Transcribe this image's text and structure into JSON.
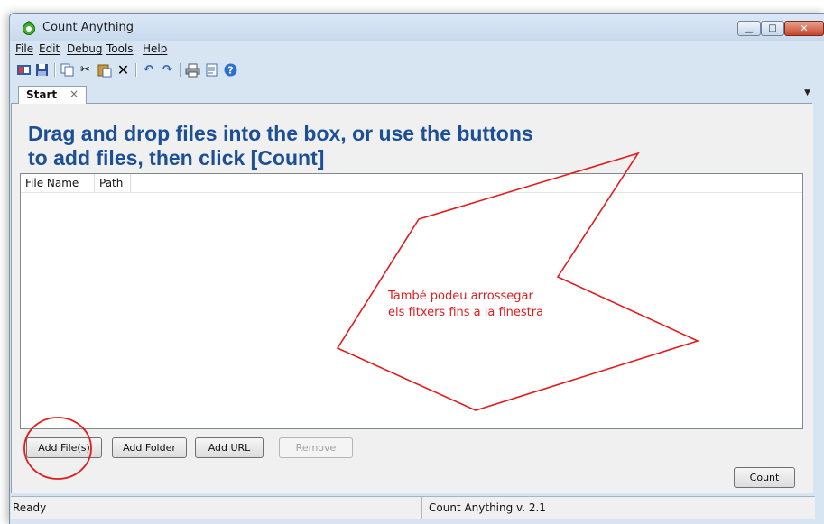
{
  "window": {
    "title": "Count Anything"
  },
  "menu": [
    "File",
    "Edit",
    "Debug",
    "Tools",
    "Help"
  ],
  "toolbar_icons": [
    "new-report-icon",
    "save-icon",
    "copy-icon",
    "cut-icon",
    "paste-icon",
    "delete-icon",
    "undo-icon",
    "redo-icon",
    "print-icon",
    "properties-icon",
    "help-icon"
  ],
  "tab": {
    "label": "Start",
    "close": "×"
  },
  "headline": {
    "line1": "Drag and drop files into the box, or use the buttons",
    "line2": "to add files, then click [Count]"
  },
  "list": {
    "columns": [
      "File Name",
      "Path"
    ]
  },
  "buttons": {
    "add_files": "Add File(s)",
    "add_folder": "Add Folder",
    "add_url": "Add URL",
    "remove": "Remove",
    "count": "Count"
  },
  "status": {
    "left": "Ready",
    "right": "Count Anything v. 2.1"
  },
  "annotation": {
    "line1": "També podeu arrossegar",
    "line2": "els fitxers fins a la finestra"
  },
  "colors": {
    "annotation": "#e31b1b",
    "headline": "#1c4f95",
    "chrome": "#d7e4f2"
  }
}
